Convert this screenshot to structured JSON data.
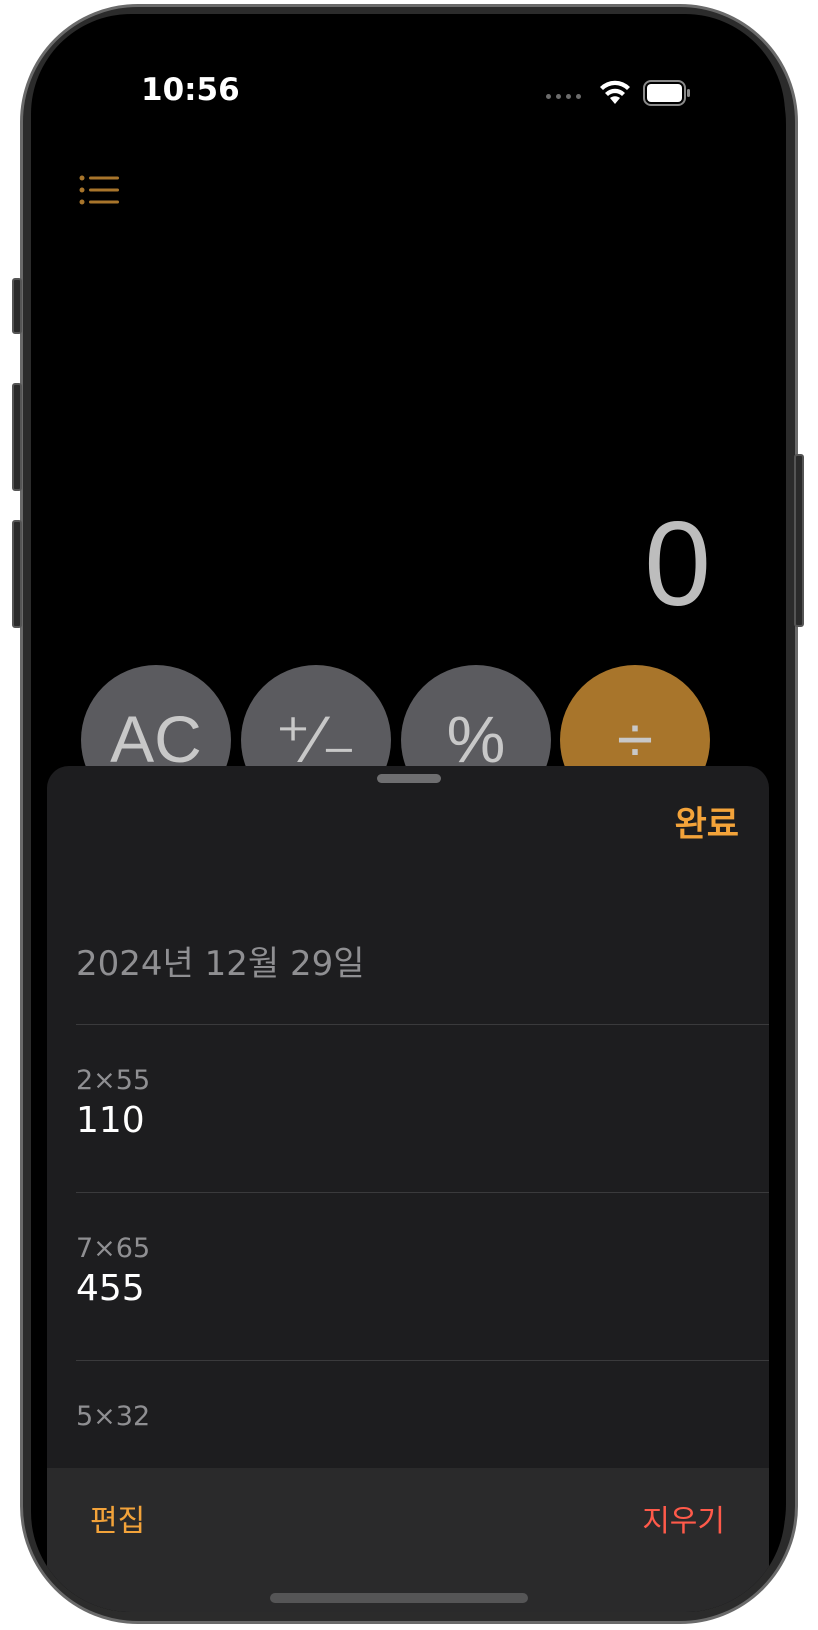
{
  "status_bar": {
    "time": "10:56"
  },
  "calculator": {
    "display_value": "0",
    "keys": [
      {
        "label": "AC",
        "style": "gray"
      },
      {
        "label": "⁺∕₋",
        "style": "gray"
      },
      {
        "label": "%",
        "style": "gray"
      },
      {
        "label": "÷",
        "style": "orange"
      }
    ]
  },
  "history_sheet": {
    "done_label": "완료",
    "date_header": "2024년 12월 29일",
    "entries": [
      {
        "expression": "2×55",
        "result": "110"
      },
      {
        "expression": "7×65",
        "result": "455"
      },
      {
        "expression": "5×32",
        "result": ""
      }
    ],
    "toolbar": {
      "edit_label": "편집",
      "clear_label": "지우기"
    }
  },
  "colors": {
    "accent": "#f3a33a",
    "destructive": "#ff5a4a",
    "operator_key": "#a8752b",
    "function_key": "#5b5b5f",
    "sheet_background": "#1d1d1f"
  },
  "icons": {
    "history": "list-bullet-icon",
    "wifi": "wifi-icon",
    "battery": "battery-icon",
    "cellular": "cellular-signal-icon"
  }
}
